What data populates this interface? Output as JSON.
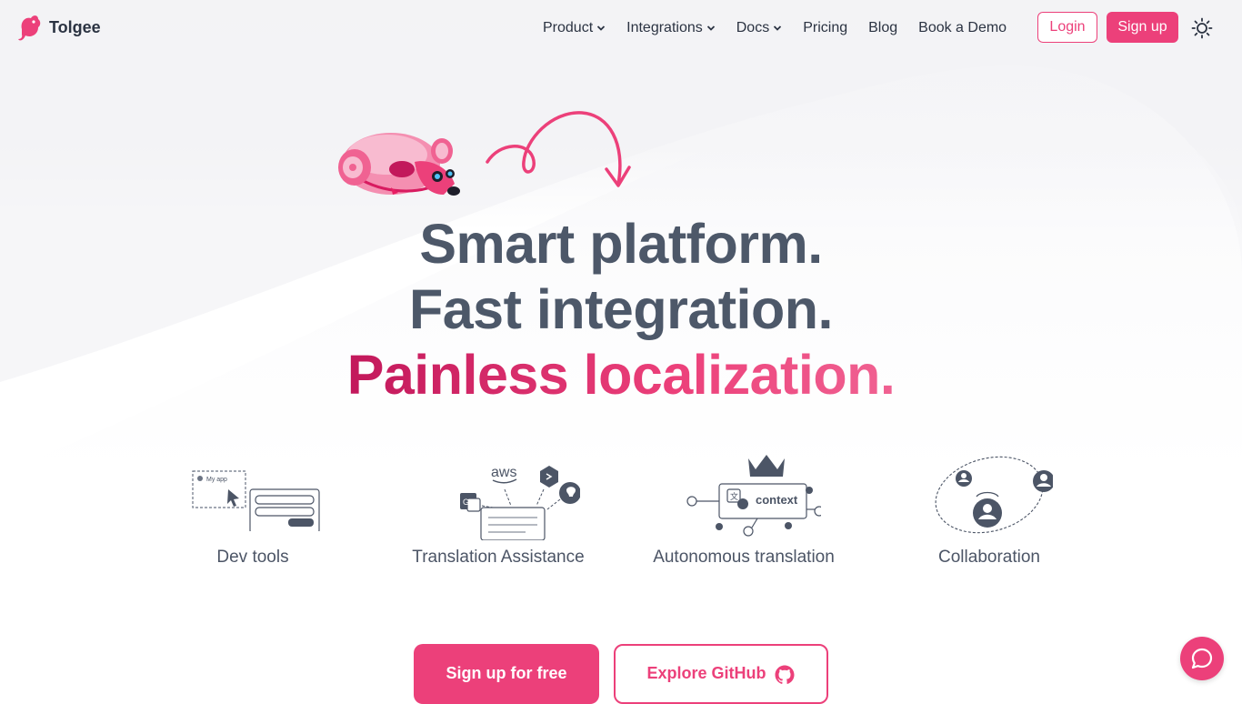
{
  "brand": {
    "name": "Tolgee",
    "accent": "#ec407a",
    "logo_icon": "tolgee-mouse-logo"
  },
  "nav": {
    "items": [
      {
        "label": "Product",
        "dropdown": true
      },
      {
        "label": "Integrations",
        "dropdown": true
      },
      {
        "label": "Docs",
        "dropdown": true
      },
      {
        "label": "Pricing",
        "dropdown": false
      },
      {
        "label": "Blog",
        "dropdown": false
      },
      {
        "label": "Book a Demo",
        "dropdown": false
      }
    ],
    "login_label": "Login",
    "signup_label": "Sign up",
    "theme_icon": "sun-icon"
  },
  "hero": {
    "line1": "Smart platform.",
    "line2": "Fast integration.",
    "line3": "Painless localization."
  },
  "features": [
    {
      "label": "Dev tools",
      "icon": "dev-tools-illustration",
      "app_label": "My app"
    },
    {
      "label": "Translation Assistance",
      "icon": "translation-assistance-illustration",
      "provider": "aws"
    },
    {
      "label": "Autonomous translation",
      "icon": "autonomous-translation-illustration",
      "tag": "context"
    },
    {
      "label": "Collaboration",
      "icon": "collaboration-illustration"
    }
  ],
  "cta": {
    "primary_label": "Sign up for free",
    "secondary_label": "Explore GitHub",
    "secondary_icon": "github-icon"
  },
  "chat": {
    "icon": "chat-bubble-icon"
  }
}
